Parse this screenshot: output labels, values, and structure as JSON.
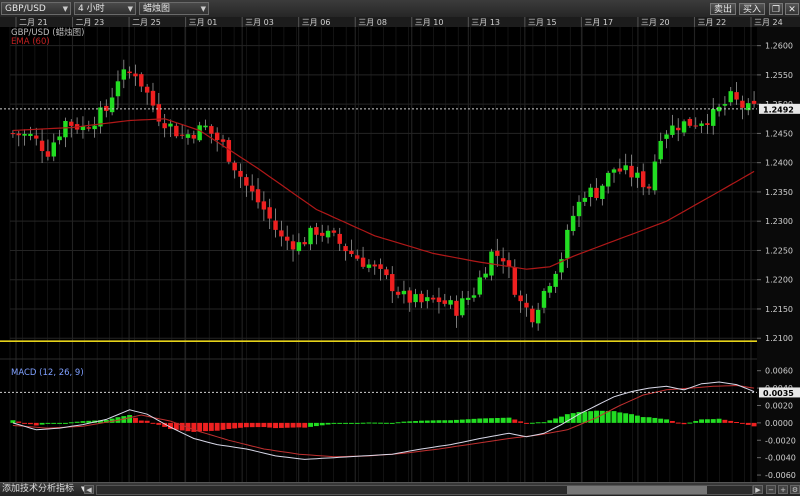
{
  "toolbar": {
    "symbol": "GBP/USD",
    "timeframe": "4 小时",
    "chart_style": "蜡烛图",
    "sell_label": "卖出",
    "buy_label": "买入"
  },
  "indicators": {
    "add_label": "添加技术分析指标"
  },
  "colors": {
    "bull": "#22dd22",
    "bear": "#ee2020",
    "ema": "#b01818",
    "support": "#e6d21a",
    "macd_line": "#d8d8e8",
    "signal_line": "#c03030",
    "grid": "#1f1f1f"
  },
  "chart_data": [
    {
      "type": "candlestick",
      "title": "GBP/USD (蜡烛图)",
      "legend": [
        "EMA (60)"
      ],
      "x_tick_labels": [
        "二月 21",
        "二月 23",
        "二月 25",
        "三月 01",
        "三月 03",
        "三月 06",
        "三月 08",
        "三月 10",
        "三月 13",
        "三月 15",
        "三月 17",
        "三月 20",
        "三月 22",
        "三月 24"
      ],
      "y_tick_labels": [
        "1.2600",
        "1.2550",
        "1.2500",
        "1.2450",
        "1.2400",
        "1.2350",
        "1.2300",
        "1.2250",
        "1.2200",
        "1.2150",
        "1.2100"
      ],
      "ylim": [
        1.2085,
        1.2625
      ],
      "last_price": "1.2492",
      "support_level": 1.2095,
      "close_path": [
        [
          0,
          1.245
        ],
        [
          3,
          1.2445
        ],
        [
          6,
          1.242
        ],
        [
          9,
          1.247
        ],
        [
          12,
          1.246
        ],
        [
          16,
          1.249
        ],
        [
          18,
          1.2545
        ],
        [
          21,
          1.2555
        ],
        [
          25,
          1.248
        ],
        [
          29,
          1.2445
        ],
        [
          33,
          1.246
        ],
        [
          36,
          1.243
        ],
        [
          40,
          1.236
        ],
        [
          43,
          1.232
        ],
        [
          46,
          1.227
        ],
        [
          49,
          1.226
        ],
        [
          52,
          1.2285
        ],
        [
          55,
          1.227
        ],
        [
          58,
          1.2245
        ],
        [
          61,
          1.2225
        ],
        [
          64,
          1.22
        ],
        [
          67,
          1.217
        ],
        [
          70,
          1.216
        ],
        [
          73,
          1.2165
        ],
        [
          76,
          1.215
        ],
        [
          79,
          1.218
        ],
        [
          82,
          1.2245
        ],
        [
          84,
          1.224
        ],
        [
          87,
          1.216
        ],
        [
          89,
          1.214
        ],
        [
          91,
          1.218
        ],
        [
          94,
          1.224
        ],
        [
          96,
          1.231
        ],
        [
          98,
          1.235
        ],
        [
          100,
          1.235
        ],
        [
          103,
          1.239
        ],
        [
          106,
          1.238
        ],
        [
          109,
          1.236
        ],
        [
          111,
          1.245
        ],
        [
          114,
          1.2465
        ],
        [
          117,
          1.247
        ],
        [
          120,
          1.248
        ],
        [
          123,
          1.251
        ],
        [
          126,
          1.249
        ],
        [
          127,
          1.2492
        ]
      ],
      "ema_path": [
        [
          0,
          1.2455
        ],
        [
          10,
          1.246
        ],
        [
          20,
          1.2472
        ],
        [
          26,
          1.2475
        ],
        [
          32,
          1.2455
        ],
        [
          42,
          1.239
        ],
        [
          52,
          1.232
        ],
        [
          62,
          1.2275
        ],
        [
          72,
          1.2245
        ],
        [
          80,
          1.223
        ],
        [
          88,
          1.2218
        ],
        [
          92,
          1.2222
        ],
        [
          96,
          1.224
        ],
        [
          104,
          1.227
        ],
        [
          112,
          1.23
        ],
        [
          120,
          1.2345
        ],
        [
          127,
          1.2385
        ]
      ]
    },
    {
      "type": "macd",
      "title": "MACD (12, 26, 9)",
      "y_tick_labels": [
        "0.0060",
        "0.0040",
        "0.0035",
        "0.0020",
        "0.0000",
        "-0.0020",
        "-0.0040",
        "-0.0060"
      ],
      "ylim": [
        -0.0068,
        0.007
      ],
      "last_value": "0.0035",
      "macd_path": [
        [
          0,
          0.0
        ],
        [
          4,
          -0.0008
        ],
        [
          8,
          -0.0006
        ],
        [
          12,
          -0.0002
        ],
        [
          16,
          0.0004
        ],
        [
          20,
          0.0015
        ],
        [
          23,
          0.001
        ],
        [
          27,
          -0.0005
        ],
        [
          31,
          -0.0018
        ],
        [
          35,
          -0.0025
        ],
        [
          40,
          -0.003
        ],
        [
          45,
          -0.0038
        ],
        [
          50,
          -0.0042
        ],
        [
          55,
          -0.004
        ],
        [
          60,
          -0.0038
        ],
        [
          65,
          -0.0036
        ],
        [
          70,
          -0.003
        ],
        [
          75,
          -0.0025
        ],
        [
          80,
          -0.0018
        ],
        [
          85,
          -0.0012
        ],
        [
          88,
          -0.0016
        ],
        [
          91,
          -0.0012
        ],
        [
          94,
          -0.0002
        ],
        [
          97,
          0.001
        ],
        [
          100,
          0.002
        ],
        [
          103,
          0.003
        ],
        [
          106,
          0.0036
        ],
        [
          109,
          0.004
        ],
        [
          112,
          0.0042
        ],
        [
          115,
          0.0038
        ],
        [
          118,
          0.0045
        ],
        [
          121,
          0.0047
        ],
        [
          124,
          0.0044
        ],
        [
          127,
          0.0036
        ]
      ],
      "signal_path": [
        [
          0,
          -0.0003
        ],
        [
          6,
          -0.0006
        ],
        [
          12,
          -0.0004
        ],
        [
          18,
          0.0003
        ],
        [
          22,
          0.0009
        ],
        [
          27,
          0.0002
        ],
        [
          32,
          -0.001
        ],
        [
          37,
          -0.002
        ],
        [
          43,
          -0.003
        ],
        [
          49,
          -0.0036
        ],
        [
          55,
          -0.0039
        ],
        [
          61,
          -0.0038
        ],
        [
          67,
          -0.0035
        ],
        [
          73,
          -0.003
        ],
        [
          79,
          -0.0024
        ],
        [
          85,
          -0.0018
        ],
        [
          90,
          -0.0014
        ],
        [
          95,
          -0.0008
        ],
        [
          100,
          0.0006
        ],
        [
          104,
          0.002
        ],
        [
          108,
          0.0032
        ],
        [
          112,
          0.0038
        ],
        [
          116,
          0.004
        ],
        [
          120,
          0.0042
        ],
        [
          124,
          0.0043
        ],
        [
          127,
          0.004
        ]
      ]
    }
  ]
}
